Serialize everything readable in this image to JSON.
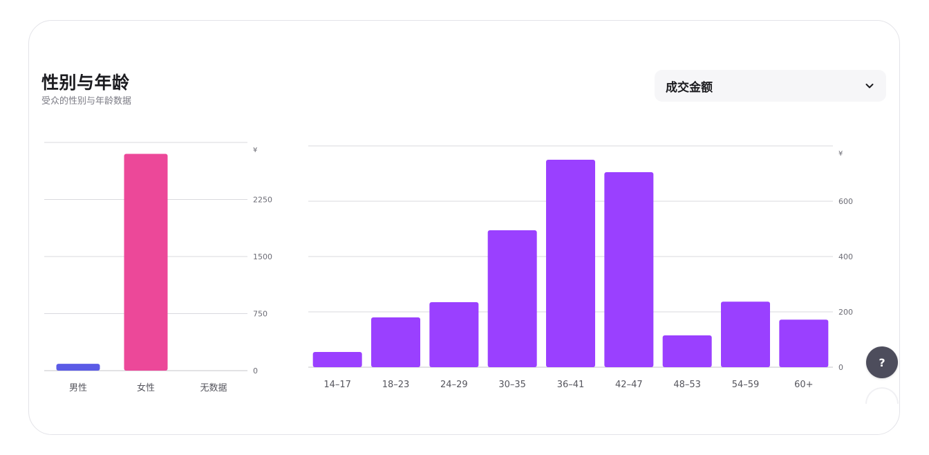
{
  "header": {
    "title": "性别与年龄",
    "subtitle": "受众的性别与年龄数据"
  },
  "metric_select": {
    "selected": "成交金额",
    "icon": "chevron-down-icon"
  },
  "help_button": {
    "label": "?",
    "icon": "help-icon"
  },
  "colors": {
    "male": "#5b5be6",
    "female": "#ec4899",
    "age": "#9a40ff",
    "grid": "#d9d9de",
    "axis_text": "#6b6b74"
  },
  "chart_data": [
    {
      "type": "bar",
      "categories": [
        "男性",
        "女性",
        "无数据"
      ],
      "values": [
        90,
        2850,
        0
      ],
      "colors": [
        "#5b5be6",
        "#ec4899",
        "#ec4899"
      ],
      "unit": "¥",
      "ylim": [
        0,
        3000
      ],
      "yticks": [
        0,
        750,
        1500,
        2250
      ],
      "grid": true,
      "y_axis_position": "right"
    },
    {
      "type": "bar",
      "categories": [
        "14–17",
        "18–23",
        "24–29",
        "30–35",
        "36–41",
        "42–47",
        "48–53",
        "54–59",
        "60+"
      ],
      "values": [
        55,
        180,
        235,
        495,
        750,
        705,
        115,
        237,
        172
      ],
      "unit": "¥",
      "ylim": [
        0,
        800
      ],
      "yticks": [
        0,
        200,
        400,
        600
      ],
      "grid": true,
      "y_axis_position": "right"
    }
  ]
}
